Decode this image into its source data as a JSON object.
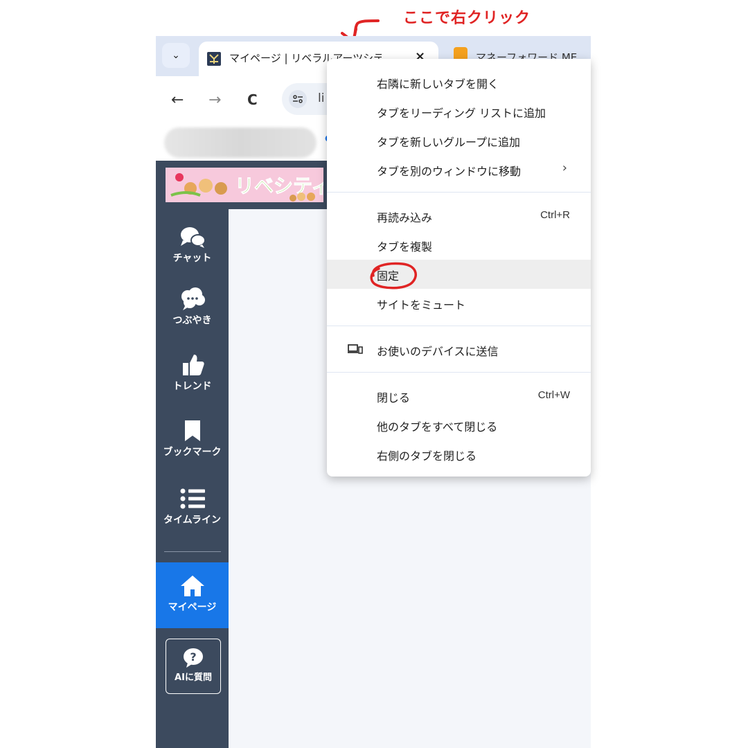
{
  "annotation": {
    "text": "ここで右クリック",
    "color": "#e02424"
  },
  "tabs": {
    "active_title": "マイページ | リベラルアーツシティ",
    "close_glyph": "×",
    "list_glyph": "⌄",
    "second_title": "マネーフォワード ME"
  },
  "toolbar": {
    "back": "←",
    "forward": "→",
    "reload": "C",
    "address_text": "li",
    "site_info_icon": "tune-icon"
  },
  "bookmarks": {
    "dot": "●"
  },
  "logo": {
    "text": "リベシティ"
  },
  "sidebar": {
    "items": [
      {
        "label": "チャット",
        "icon": "chat-bubbles-icon"
      },
      {
        "label": "つぶやき",
        "icon": "cloud-bubble-icon"
      },
      {
        "label": "トレンド",
        "icon": "thumbs-up-icon"
      },
      {
        "label": "ブックマーク",
        "icon": "bookmark-icon"
      },
      {
        "label": "タイムライン",
        "icon": "list-icon"
      },
      {
        "label": "マイページ",
        "icon": "home-icon"
      },
      {
        "label": "AIに質問",
        "icon": "question-bubble-icon"
      }
    ],
    "bg_color": "#3c4a5e",
    "active_color": "#1877e8"
  },
  "context_menu": {
    "items": [
      {
        "label": "右隣に新しいタブを開く"
      },
      {
        "label": "タブをリーディング リストに追加"
      },
      {
        "label": "タブを新しいグループに追加"
      },
      {
        "label": "タブを別のウィンドウに移動",
        "submenu": "›"
      },
      {
        "label": "再読み込み",
        "shortcut": "Ctrl+R"
      },
      {
        "label": "タブを複製"
      },
      {
        "label": "固定"
      },
      {
        "label": "サイトをミュート"
      },
      {
        "label": "お使いのデバイスに送信",
        "icon": "devices-icon"
      },
      {
        "label": "閉じる",
        "shortcut": "Ctrl+W"
      },
      {
        "label": "他のタブをすべて閉じる"
      },
      {
        "label": "右側のタブを閉じる"
      }
    ],
    "highlighted": "固定"
  }
}
